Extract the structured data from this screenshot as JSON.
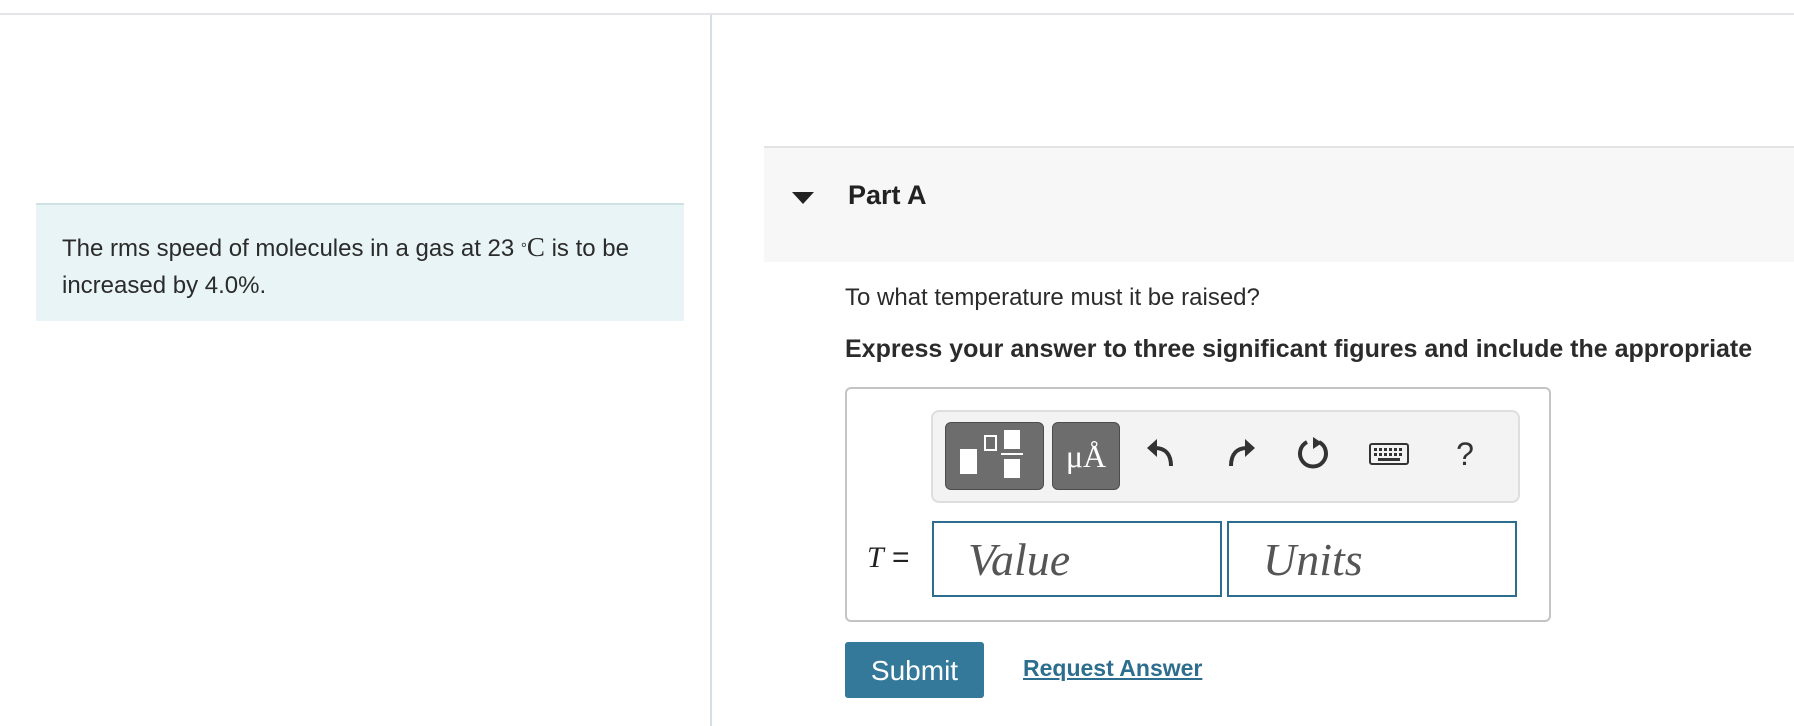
{
  "problem": {
    "text_before": "The rms speed of molecules in a gas at 23 ",
    "degree_symbol": "°",
    "unit_C": "C",
    "text_after": " is to be increased by 4.0%."
  },
  "part": {
    "title": "Part A",
    "question": "To what temperature must it be raised?",
    "instruction": "Express your answer to three significant figures and include the appropriate"
  },
  "toolbar": {
    "units_label": "μÅ",
    "undo_icon": "undo-icon",
    "redo_icon": "redo-icon",
    "reset_icon": "reset-icon",
    "keyboard_icon": "keyboard-icon",
    "help_label": "?"
  },
  "answer": {
    "variable": "T",
    "equals": " =",
    "value_placeholder": "Value",
    "units_placeholder": "Units"
  },
  "actions": {
    "submit_label": "Submit",
    "request_answer_label": "Request Answer"
  },
  "colors": {
    "problem_bg": "#e8f4f6",
    "accent": "#34789a",
    "field_border": "#2d6e8e"
  }
}
